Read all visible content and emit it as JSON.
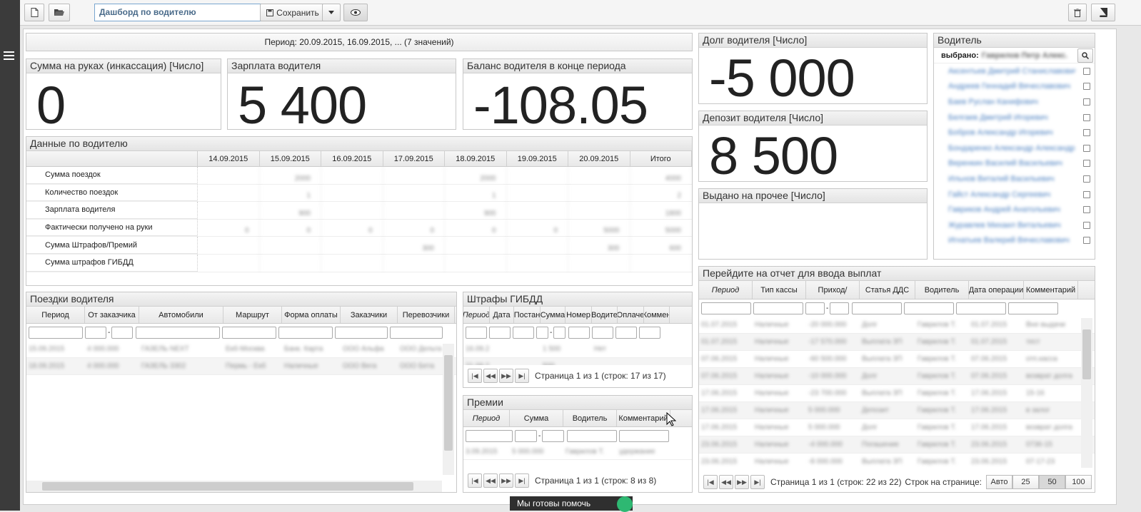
{
  "toolbar": {
    "title_value": "Дашборд по водителю",
    "save_label": "Сохранить"
  },
  "period": "Период: 20.09.2015, 16.09.2015, ... (7 значений)",
  "kpi": {
    "cash": {
      "title": "Сумма на руках (инкассация) [Число]",
      "value": "0"
    },
    "salary": {
      "title": "Зарплата водителя",
      "value": "5 400"
    },
    "balance": {
      "title": "Баланс водителя в конце периода",
      "value": "-108.05"
    },
    "debt": {
      "title": "Долг водителя [Число]",
      "value": "-5 000"
    },
    "deposit": {
      "title": "Депозит водителя [Число]",
      "value": "8 500"
    },
    "other": {
      "title": "Выдано на прочее [Число]",
      "value": ""
    }
  },
  "driver_data": {
    "title": "Данные по водителю",
    "columns": [
      "14.09.2015",
      "15.09.2015",
      "16.09.2015",
      "17.09.2015",
      "18.09.2015",
      "19.09.2015",
      "20.09.2015",
      "Итого"
    ],
    "rows": [
      {
        "label": "Сумма поездок",
        "cells": [
          "",
          "2000",
          "",
          "",
          "2000",
          "",
          "",
          "4000"
        ]
      },
      {
        "label": "Количество поездок",
        "cells": [
          "",
          "1",
          "",
          "",
          "1",
          "",
          "",
          "2"
        ]
      },
      {
        "label": "Зарплата водителя",
        "cells": [
          "",
          "900",
          "",
          "",
          "900",
          "",
          "",
          "1800"
        ]
      },
      {
        "label": "Фактически получено на руки",
        "cells": [
          "0",
          "0",
          "0",
          "0",
          "0",
          "0",
          "5000",
          "5000"
        ]
      },
      {
        "label": "Сумма Штрафов/Премий",
        "cells": [
          "",
          "",
          "",
          "300",
          "",
          "",
          "300",
          "600"
        ]
      },
      {
        "label": "Сумма штрафов ГИБДД",
        "cells": [
          "",
          "",
          "",
          "",
          "",
          "",
          "",
          ""
        ]
      }
    ]
  },
  "trips": {
    "title": "Поездки водителя",
    "columns": [
      "Период",
      "От заказчика",
      "Автомобили",
      "Маршрут",
      "Форма оплаты",
      "Заказчики",
      "Перевозчики"
    ],
    "rows": [
      [
        "15.09.2015",
        "4 000.000",
        "ГАЗЕЛЬ NEXT",
        "Екб-Москва",
        "Банк. Карта",
        "ООО Альфа",
        "ООО Дельта"
      ],
      [
        "18.09.2015",
        "4 000.000",
        "ГАЗЕЛЬ 3302",
        "Пермь - Екб",
        "Наличные",
        "ООО Вега",
        "ООО Бета"
      ]
    ]
  },
  "fines": {
    "title": "Штрафы ГИБДД",
    "columns": [
      "Период",
      "Дата",
      "Постан",
      "Сумма",
      "Номер",
      "Водите",
      "Оплаче",
      "Коммен"
    ],
    "rows": [
      [
        "16.09.2",
        "",
        "",
        "1 500",
        "",
        "Нет",
        "",
        ""
      ],
      [
        "21.09.2",
        "",
        "",
        "500",
        "",
        "",
        "",
        ""
      ]
    ],
    "pager": "Страница 1 из 1 (строк: 17 из 17)"
  },
  "bonuses": {
    "title": "Премии",
    "columns": [
      "Период",
      "Сумма",
      "Водитель",
      "Комментарий"
    ],
    "rows": [
      [
        "3.09.2015",
        "5 000.000",
        "Гаврилов Т.",
        "удержание"
      ]
    ],
    "pager": "Страница 1 из 1 (строк: 8 из 8)"
  },
  "driver_filter": {
    "title": "Водитель",
    "selected_label": "выбрано:",
    "selected_value": "Гаврилов Петр Алекс...",
    "items": [
      "Аксентьев Дмитрий Станиславович",
      "Андреев Геннадий Вячеславович",
      "Баев Руслан Канифович",
      "Белгаев Дмитрий Игоревич",
      "Бобров Александр Игоревич",
      "Бондаренко Александр Александрович",
      "Веренкин Василий Васильевич",
      "Ильнов Виталий Васильевич",
      "Гайст Александр Сергеевич",
      "Гавриков Андрей Анатольевич",
      "Журавлев Михаил Витальевич",
      "Игнатьев Валерий Вячеславович"
    ]
  },
  "payments": {
    "title": "Перейдите на отчет для ввода выплат",
    "columns": [
      "Период",
      "Тип кассы",
      "Приход/",
      "Статья ДДС",
      "Водитель",
      "Дата операции",
      "Комментарий"
    ],
    "rows": [
      [
        "01.07.2015",
        "Наличные",
        "-20 000.000",
        "Долг",
        "Гаврилов Т.",
        "01.07.2015",
        "Вне выдачи"
      ],
      [
        "01.07.2015",
        "Наличные",
        "-17 570.000",
        "Выплата ЗП",
        "Гаврилов Т.",
        "01.07.2015",
        "тест"
      ],
      [
        "07.06.2015",
        "Наличные",
        "-60 500.000",
        "Выплата ЗП",
        "Гаврилов Т.",
        "07.06.2015",
        "отп.касса"
      ],
      [
        "07.06.2015",
        "Наличные",
        "-10 000.000",
        "Долг",
        "Гаврилов Т.",
        "07.06.2015",
        "возврат долга"
      ],
      [
        "17.06.2015",
        "Наличные",
        "-23 700.000",
        "Выплата ЗП",
        "Гаврилов Т.",
        "17.06.2015",
        "15-16"
      ],
      [
        "17.06.2015",
        "Наличные",
        "5 000.000",
        "Депозит",
        "Гаврилов Т.",
        "17.06.2015",
        "в залог"
      ],
      [
        "17.06.2015",
        "Наличные",
        "5 000.000",
        "Долг",
        "Гаврилов Т.",
        "17.06.2015",
        "возврат долга"
      ],
      [
        "23.06.2015",
        "Наличные",
        "-4 000.000",
        "Погашение",
        "Гаврилов Т.",
        "23.06.2015",
        "0736-15"
      ],
      [
        "23.06.2015",
        "Наличные",
        "-8 000.000",
        "Выплата ЗП",
        "Гаврилов Т.",
        "23.06.2015",
        "07-17-23"
      ]
    ],
    "pager": "Страница 1 из 1 (строк: 22 из 22)",
    "page_size_label": "Строк на странице:",
    "page_sizes": [
      "Авто",
      "25",
      "50",
      "100"
    ]
  },
  "help_label": "Мы готовы помочь",
  "colors": {
    "sidebar": "#3b3b3b",
    "accent": "#7aa7d0",
    "help": "#2f2f2f",
    "help_badge": "#2eb872"
  }
}
